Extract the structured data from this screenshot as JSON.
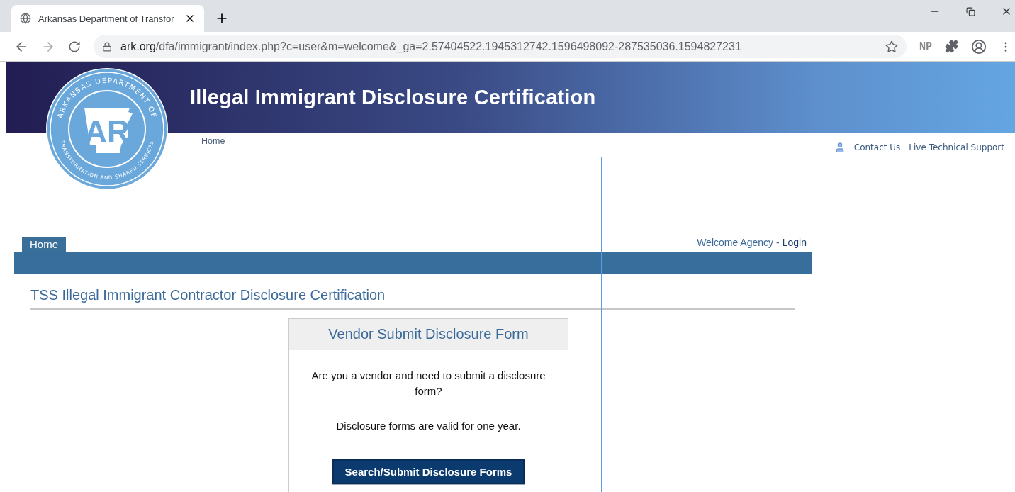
{
  "browser": {
    "tab_title": "Arkansas Department of Transfor",
    "url_domain": "ark.org",
    "url_path": "/dfa/immigrant/index.php?c=user&m=welcome&_ga=2.57404522.1945312742.1596498092-287535036.1594827231",
    "extension_label": "NP"
  },
  "logo": {
    "top_text": "ARKANSAS DEPARTMENT OF",
    "bottom_text": "TRANSFORMATION AND SHARED SERVICES",
    "monogram": "AR"
  },
  "header": {
    "title": "Illegal Immigrant Disclosure Certification"
  },
  "top_links": {
    "home": "Home",
    "contact": "Contact Us",
    "support": "Live Technical Support"
  },
  "nav": {
    "tabs": [
      {
        "label": "Home",
        "selected": true
      }
    ],
    "welcome": "Welcome Agency",
    "separator": "-",
    "login": "Login"
  },
  "page_heading": "TSS Illegal Immigrant Contractor Disclosure Certification",
  "card": {
    "title": "Vendor Submit Disclosure Form",
    "question": "Are you a vendor and need to submit a disclosure form?",
    "note": "Disclosure forms are valid for one year.",
    "button": "Search/Submit Disclosure Forms"
  }
}
